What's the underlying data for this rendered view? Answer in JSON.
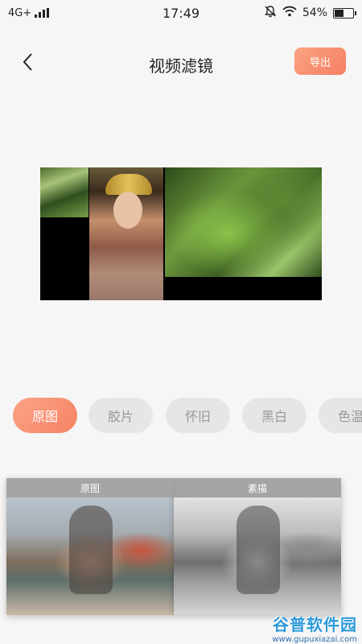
{
  "status_bar": {
    "network": "4G+",
    "time": "17:49",
    "battery_percent": "54%",
    "battery_level": 0.54,
    "icons": [
      "signal-icon",
      "mute-icon",
      "wifi-icon",
      "battery-icon"
    ]
  },
  "header": {
    "back_icon": "chevron-left-icon",
    "title": "视频滤镜",
    "export_label": "导出"
  },
  "colors": {
    "accent": "#f58264",
    "chip_inactive_bg": "#e6e6e6",
    "chip_inactive_text": "#999999",
    "background": "#f6f6f6"
  },
  "filters": [
    {
      "label": "原图",
      "active": true
    },
    {
      "label": "胶片",
      "active": false
    },
    {
      "label": "怀旧",
      "active": false
    },
    {
      "label": "黑白",
      "active": false
    },
    {
      "label": "色温",
      "active": false
    }
  ],
  "thumbnails": [
    {
      "caption": "原图",
      "style": "color"
    },
    {
      "caption": "素描",
      "style": "grayscale"
    }
  ],
  "watermark": {
    "main": "谷普软件园",
    "url": "www.gupuxiazai.com"
  }
}
